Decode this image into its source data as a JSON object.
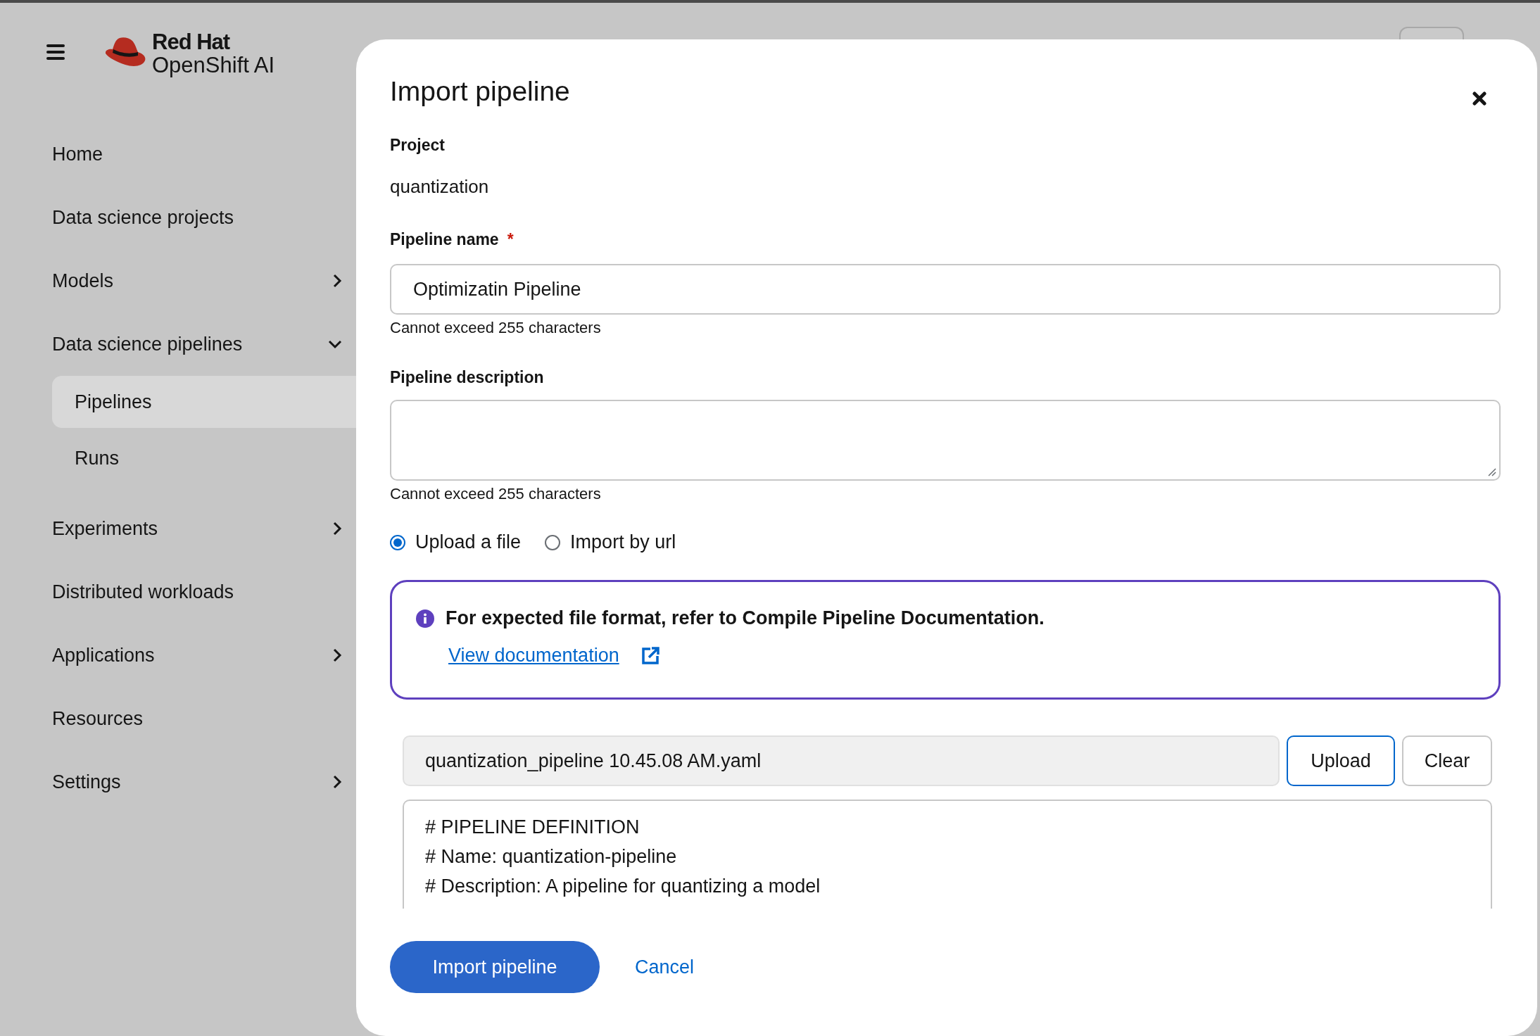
{
  "brand": {
    "line_1": "Red Hat",
    "line_2": "OpenShift AI"
  },
  "nav": [
    {
      "label": "Home",
      "kind": "link"
    },
    {
      "label": "Data science projects",
      "kind": "link"
    },
    {
      "label": "Models",
      "kind": "group",
      "expanded": false
    },
    {
      "label": "Data science pipelines",
      "kind": "group",
      "expanded": true,
      "children": [
        {
          "label": "Pipelines",
          "selected": true
        },
        {
          "label": "Runs",
          "selected": false
        }
      ]
    },
    {
      "label": "Experiments",
      "kind": "group",
      "expanded": false
    },
    {
      "label": "Distributed workloads",
      "kind": "link"
    },
    {
      "label": "Applications",
      "kind": "group",
      "expanded": false
    },
    {
      "label": "Resources",
      "kind": "link"
    },
    {
      "label": "Settings",
      "kind": "group",
      "expanded": false
    }
  ],
  "modal": {
    "title": "Import pipeline",
    "project": {
      "label": "Project",
      "value": "quantization"
    },
    "name_field": {
      "label": "Pipeline name",
      "required_mark": "*",
      "value": "Optimizatin Pipeline",
      "helper": "Cannot exceed 255 characters"
    },
    "description_field": {
      "label": "Pipeline description",
      "helper": "Cannot exceed 255 characters"
    },
    "source_options": [
      {
        "label": "Upload a file",
        "selected": true
      },
      {
        "label": "Import by url",
        "selected": false
      }
    ],
    "alert": {
      "title": "For expected file format, refer to Compile Pipeline Documentation.",
      "link": "View documentation"
    },
    "file": {
      "filename": "quantization_pipeline 10.45.08 AM.yaml",
      "buttons": [
        "Upload",
        "Clear"
      ]
    },
    "code_lines": [
      "# PIPELINE DEFINITION",
      "# Name: quantization-pipeline",
      "# Description: A pipeline for quantizing a model"
    ],
    "actions": {
      "primary": "Import pipeline",
      "secondary": "Cancel"
    }
  }
}
